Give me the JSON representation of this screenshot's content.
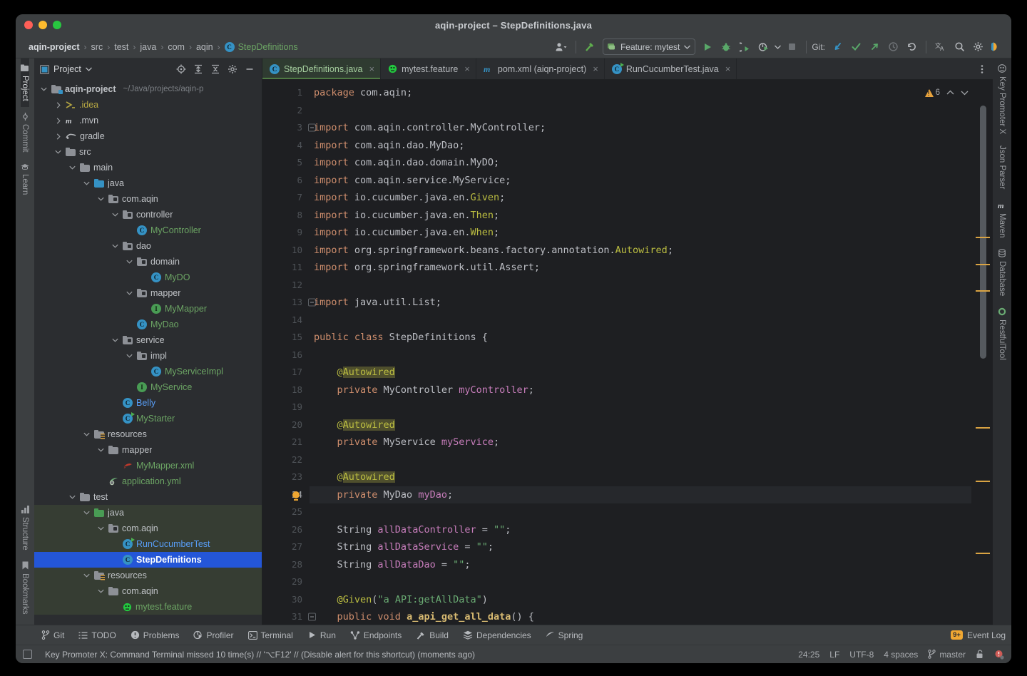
{
  "window": {
    "title": "aqin-project – StepDefinitions.java",
    "traffic_lights": [
      "close-red",
      "minimize-yellow",
      "maximize-green"
    ]
  },
  "breadcrumb": {
    "items": [
      "aqin-project",
      "src",
      "test",
      "java",
      "com",
      "aqin"
    ],
    "leaf": "StepDefinitions",
    "separator": "›"
  },
  "toolbar": {
    "run_config_label": "Feature: mytest",
    "git_label": "Git:",
    "icons": [
      "user-avatar-icon",
      "build-hammer-icon",
      "run-icon",
      "debug-icon",
      "run-with-coverage-icon",
      "profiler-icon",
      "stop-icon",
      "git-update-icon",
      "git-commit-check-icon",
      "git-push-icon",
      "history-icon",
      "rollback-icon",
      "translate-icon",
      "search-icon",
      "settings-gear-icon",
      "ai-assistant-icon"
    ]
  },
  "left_strip": {
    "top": [
      {
        "label": "Project",
        "icon": "project-icon",
        "active": true
      },
      {
        "label": "Commit",
        "icon": "commit-icon",
        "active": false
      },
      {
        "label": "Learn",
        "icon": "learn-icon",
        "active": false
      }
    ],
    "bottom": [
      {
        "label": "Structure",
        "icon": "structure-icon",
        "active": false
      },
      {
        "label": "Bookmarks",
        "icon": "bookmarks-icon",
        "active": false
      }
    ]
  },
  "right_strip": {
    "items": [
      {
        "label": "Key Promoter X",
        "icon": "key-promoter-icon"
      },
      {
        "label": "Json Parser",
        "icon": "json-parser-icon"
      },
      {
        "label": "Maven",
        "icon": "maven-icon"
      },
      {
        "label": "Database",
        "icon": "database-icon"
      },
      {
        "label": "RestfulTool",
        "icon": "restful-tool-icon"
      }
    ]
  },
  "project_panel": {
    "title": "Project",
    "dropdown_icon": "chevron-down-icon",
    "actions": [
      "locate-icon",
      "expand-all-icon",
      "collapse-all-icon",
      "settings-gear-icon",
      "hide-icon"
    ],
    "tree": [
      {
        "depth": 0,
        "arrow": "down",
        "icon": "module-folder",
        "label": "aqin-project",
        "sub": "~/Java/projects/aqin-p",
        "bold": true,
        "color": "default"
      },
      {
        "depth": 1,
        "arrow": "right",
        "icon": "idea-folder",
        "label": ".idea",
        "color": "yellow"
      },
      {
        "depth": 1,
        "arrow": "right",
        "icon": "maven-icon",
        "label": ".mvn",
        "color": "default"
      },
      {
        "depth": 1,
        "arrow": "right",
        "icon": "gradle-icon",
        "label": "gradle",
        "color": "default"
      },
      {
        "depth": 1,
        "arrow": "down",
        "icon": "folder",
        "label": "src",
        "color": "default"
      },
      {
        "depth": 2,
        "arrow": "down",
        "icon": "folder",
        "label": "main",
        "color": "default"
      },
      {
        "depth": 3,
        "arrow": "down",
        "icon": "source-folder",
        "label": "java",
        "color": "default"
      },
      {
        "depth": 4,
        "arrow": "down",
        "icon": "package",
        "label": "com.aqin",
        "color": "default"
      },
      {
        "depth": 5,
        "arrow": "down",
        "icon": "package",
        "label": "controller",
        "color": "default"
      },
      {
        "depth": 6,
        "arrow": "none",
        "icon": "class",
        "label": "MyController",
        "color": "green"
      },
      {
        "depth": 5,
        "arrow": "down",
        "icon": "package",
        "label": "dao",
        "color": "default"
      },
      {
        "depth": 6,
        "arrow": "down",
        "icon": "package",
        "label": "domain",
        "color": "default"
      },
      {
        "depth": 7,
        "arrow": "none",
        "icon": "class",
        "label": "MyDO",
        "color": "green"
      },
      {
        "depth": 6,
        "arrow": "down",
        "icon": "package",
        "label": "mapper",
        "color": "default"
      },
      {
        "depth": 7,
        "arrow": "none",
        "icon": "interface",
        "label": "MyMapper",
        "color": "green"
      },
      {
        "depth": 6,
        "arrow": "none",
        "icon": "class",
        "label": "MyDao",
        "color": "green"
      },
      {
        "depth": 5,
        "arrow": "down",
        "icon": "package",
        "label": "service",
        "color": "default"
      },
      {
        "depth": 6,
        "arrow": "down",
        "icon": "package",
        "label": "impl",
        "color": "default"
      },
      {
        "depth": 7,
        "arrow": "none",
        "icon": "class",
        "label": "MyServiceImpl",
        "color": "green"
      },
      {
        "depth": 6,
        "arrow": "none",
        "icon": "interface",
        "label": "MyService",
        "color": "green"
      },
      {
        "depth": 5,
        "arrow": "none",
        "icon": "class",
        "label": "Belly",
        "color": "blue"
      },
      {
        "depth": 5,
        "arrow": "none",
        "icon": "class-runnable",
        "label": "MyStarter",
        "color": "green"
      },
      {
        "depth": 3,
        "arrow": "down",
        "icon": "resource-folder",
        "label": "resources",
        "color": "default"
      },
      {
        "depth": 4,
        "arrow": "down",
        "icon": "folder",
        "label": "mapper",
        "color": "default"
      },
      {
        "depth": 5,
        "arrow": "none",
        "icon": "mybatis-xml",
        "label": "MyMapper.xml",
        "color": "green"
      },
      {
        "depth": 4,
        "arrow": "none",
        "icon": "yml-icon",
        "label": "application.yml",
        "color": "green"
      },
      {
        "depth": 2,
        "arrow": "down",
        "icon": "folder",
        "label": "test",
        "color": "default"
      },
      {
        "depth": 3,
        "arrow": "down",
        "icon": "test-source-folder",
        "label": "java",
        "color": "default",
        "scope": "test"
      },
      {
        "depth": 4,
        "arrow": "down",
        "icon": "package",
        "label": "com.aqin",
        "color": "default",
        "scope": "test"
      },
      {
        "depth": 5,
        "arrow": "none",
        "icon": "class-runnable",
        "label": "RunCucumberTest",
        "color": "blue",
        "scope": "test"
      },
      {
        "depth": 5,
        "arrow": "none",
        "icon": "class",
        "label": "StepDefinitions",
        "color": "default",
        "scope": "test",
        "selected": true
      },
      {
        "depth": 3,
        "arrow": "down",
        "icon": "test-resource-folder",
        "label": "resources",
        "color": "default",
        "scope": "test"
      },
      {
        "depth": 4,
        "arrow": "down",
        "icon": "folder",
        "label": "com.aqin",
        "color": "default",
        "scope": "test"
      },
      {
        "depth": 5,
        "arrow": "none",
        "icon": "cucumber-icon",
        "label": "mytest.feature",
        "color": "green",
        "scope": "test"
      }
    ]
  },
  "editor_tabs": [
    {
      "label": "StepDefinitions.java",
      "icon": "java-class-icon",
      "active": true,
      "close": "×"
    },
    {
      "label": "mytest.feature",
      "icon": "cucumber-icon",
      "active": false,
      "close": "×"
    },
    {
      "label": "pom.xml (aiqn-project)",
      "icon": "maven-icon",
      "active": false,
      "close": "×"
    },
    {
      "label": "RunCucumberTest.java",
      "icon": "java-test-icon",
      "active": false,
      "close": "×"
    }
  ],
  "editor": {
    "inspection_count": "6",
    "inspection_icon": "warning-triangle-icon",
    "up_icon": "chevron-up-icon",
    "down_icon": "chevron-down-icon",
    "current_line": 24,
    "lines": [
      {
        "n": 1,
        "tokens": [
          {
            "t": "package ",
            "c": "k"
          },
          {
            "t": "com.aqin",
            "c": "n"
          },
          {
            "t": ";",
            "c": "p"
          }
        ]
      },
      {
        "n": 2,
        "tokens": []
      },
      {
        "n": 3,
        "fold": true,
        "tokens": [
          {
            "t": "import ",
            "c": "k"
          },
          {
            "t": "com.aqin.controller.MyController",
            "c": "n"
          },
          {
            "t": ";",
            "c": "p"
          }
        ]
      },
      {
        "n": 4,
        "tokens": [
          {
            "t": "import ",
            "c": "k"
          },
          {
            "t": "com.aqin.dao.MyDao",
            "c": "n"
          },
          {
            "t": ";",
            "c": "p"
          }
        ]
      },
      {
        "n": 5,
        "tokens": [
          {
            "t": "import ",
            "c": "k"
          },
          {
            "t": "com.aqin.dao.domain.MyDO",
            "c": "n"
          },
          {
            "t": ";",
            "c": "p"
          }
        ]
      },
      {
        "n": 6,
        "tokens": [
          {
            "t": "import ",
            "c": "k"
          },
          {
            "t": "com.aqin.service.MyService",
            "c": "n"
          },
          {
            "t": ";",
            "c": "p"
          }
        ]
      },
      {
        "n": 7,
        "tokens": [
          {
            "t": "import ",
            "c": "k"
          },
          {
            "t": "io.cucumber.java.en.",
            "c": "n"
          },
          {
            "t": "Given",
            "c": "a"
          },
          {
            "t": ";",
            "c": "p"
          }
        ]
      },
      {
        "n": 8,
        "tokens": [
          {
            "t": "import ",
            "c": "k"
          },
          {
            "t": "io.cucumber.java.en.",
            "c": "n"
          },
          {
            "t": "Then",
            "c": "a"
          },
          {
            "t": ";",
            "c": "p"
          }
        ]
      },
      {
        "n": 9,
        "tokens": [
          {
            "t": "import ",
            "c": "k"
          },
          {
            "t": "io.cucumber.java.en.",
            "c": "n"
          },
          {
            "t": "When",
            "c": "a"
          },
          {
            "t": ";",
            "c": "p"
          }
        ]
      },
      {
        "n": 10,
        "tokens": [
          {
            "t": "import ",
            "c": "k"
          },
          {
            "t": "org.springframework.beans.factory.annotation.",
            "c": "n"
          },
          {
            "t": "Autowired",
            "c": "a"
          },
          {
            "t": ";",
            "c": "p"
          }
        ]
      },
      {
        "n": 11,
        "tokens": [
          {
            "t": "import ",
            "c": "k"
          },
          {
            "t": "org.springframework.util.Assert",
            "c": "n"
          },
          {
            "t": ";",
            "c": "p"
          }
        ]
      },
      {
        "n": 12,
        "tokens": []
      },
      {
        "n": 13,
        "fold": true,
        "tokens": [
          {
            "t": "import ",
            "c": "k"
          },
          {
            "t": "java.util.List",
            "c": "n"
          },
          {
            "t": ";",
            "c": "p"
          }
        ]
      },
      {
        "n": 14,
        "tokens": []
      },
      {
        "n": 15,
        "tokens": [
          {
            "t": "public class ",
            "c": "k"
          },
          {
            "t": "StepDefinitions",
            "c": "n"
          },
          {
            "t": " {",
            "c": "p"
          }
        ]
      },
      {
        "n": 16,
        "tokens": []
      },
      {
        "n": 17,
        "tokens": [
          {
            "t": "    ",
            "c": "p"
          },
          {
            "t": "@",
            "c": "a"
          },
          {
            "t": "Autowired",
            "c": "hl"
          }
        ]
      },
      {
        "n": 18,
        "tokens": [
          {
            "t": "    ",
            "c": "p"
          },
          {
            "t": "private ",
            "c": "k"
          },
          {
            "t": "MyController ",
            "c": "n"
          },
          {
            "t": "myController",
            "c": "f"
          },
          {
            "t": ";",
            "c": "p"
          }
        ]
      },
      {
        "n": 19,
        "tokens": []
      },
      {
        "n": 20,
        "tokens": [
          {
            "t": "    ",
            "c": "p"
          },
          {
            "t": "@",
            "c": "a"
          },
          {
            "t": "Autowired",
            "c": "hl"
          }
        ]
      },
      {
        "n": 21,
        "tokens": [
          {
            "t": "    ",
            "c": "p"
          },
          {
            "t": "private ",
            "c": "k"
          },
          {
            "t": "MyService ",
            "c": "n"
          },
          {
            "t": "myService",
            "c": "f"
          },
          {
            "t": ";",
            "c": "p"
          }
        ]
      },
      {
        "n": 22,
        "tokens": []
      },
      {
        "n": 23,
        "tokens": [
          {
            "t": "    ",
            "c": "p"
          },
          {
            "t": "@",
            "c": "a"
          },
          {
            "t": "Autowired",
            "c": "hl"
          }
        ]
      },
      {
        "n": 24,
        "bulb": true,
        "cur": true,
        "tokens": [
          {
            "t": "    ",
            "c": "p"
          },
          {
            "t": "private ",
            "c": "k"
          },
          {
            "t": "MyDao ",
            "c": "n"
          },
          {
            "t": "myDao",
            "c": "f"
          },
          {
            "t": ";",
            "c": "p"
          }
        ]
      },
      {
        "n": 25,
        "tokens": []
      },
      {
        "n": 26,
        "tokens": [
          {
            "t": "    ",
            "c": "p"
          },
          {
            "t": "String ",
            "c": "n"
          },
          {
            "t": "allDataController",
            "c": "f"
          },
          {
            "t": " = ",
            "c": "p"
          },
          {
            "t": "\"\"",
            "c": "s"
          },
          {
            "t": ";",
            "c": "p"
          }
        ]
      },
      {
        "n": 27,
        "tokens": [
          {
            "t": "    ",
            "c": "p"
          },
          {
            "t": "String ",
            "c": "n"
          },
          {
            "t": "allDataService",
            "c": "f"
          },
          {
            "t": " = ",
            "c": "p"
          },
          {
            "t": "\"\"",
            "c": "s"
          },
          {
            "t": ";",
            "c": "p"
          }
        ]
      },
      {
        "n": 28,
        "tokens": [
          {
            "t": "    ",
            "c": "p"
          },
          {
            "t": "String ",
            "c": "n"
          },
          {
            "t": "allDataDao",
            "c": "f"
          },
          {
            "t": " = ",
            "c": "p"
          },
          {
            "t": "\"\"",
            "c": "s"
          },
          {
            "t": ";",
            "c": "p"
          }
        ]
      },
      {
        "n": 29,
        "tokens": []
      },
      {
        "n": 30,
        "tokens": [
          {
            "t": "    ",
            "c": "p"
          },
          {
            "t": "@Given",
            "c": "a"
          },
          {
            "t": "(",
            "c": "p"
          },
          {
            "t": "\"a API:getAllData\"",
            "c": "s"
          },
          {
            "t": ")",
            "c": "p"
          }
        ]
      },
      {
        "n": 31,
        "fold": true,
        "tokens": [
          {
            "t": "    ",
            "c": "p"
          },
          {
            "t": "public void ",
            "c": "k"
          },
          {
            "t": "a_api_get_all_data",
            "c": "mn"
          },
          {
            "t": "() {",
            "c": "p"
          }
        ]
      }
    ]
  },
  "bottom_tool_window": {
    "items": [
      {
        "label": "Git",
        "icon": "git-branch-icon"
      },
      {
        "label": "TODO",
        "icon": "todo-list-icon"
      },
      {
        "label": "Problems",
        "icon": "problems-icon"
      },
      {
        "label": "Profiler",
        "icon": "profiler-icon"
      },
      {
        "label": "Terminal",
        "icon": "terminal-icon"
      },
      {
        "label": "Run",
        "icon": "run-icon"
      },
      {
        "label": "Endpoints",
        "icon": "endpoints-icon"
      },
      {
        "label": "Build",
        "icon": "build-hammer-icon"
      },
      {
        "label": "Dependencies",
        "icon": "dependencies-icon"
      },
      {
        "label": "Spring",
        "icon": "spring-leaf-icon"
      }
    ],
    "event_log": {
      "label": "Event Log",
      "badge": "9+",
      "icon": "event-log-icon"
    }
  },
  "statusbar": {
    "message": "Key Promoter X: Command Terminal missed 10 time(s) // '⌥F12' // (Disable alert for this shortcut) (moments ago)",
    "message_icon": "notification-icon",
    "caret_position": "24:25",
    "line_separator": "LF",
    "encoding": "UTF-8",
    "indent": "4 spaces",
    "branch": "master",
    "branch_icon": "git-branch-icon",
    "lock_icon": "read-write-lock-icon",
    "inspection_icon": "inspection-level-icon"
  },
  "colors": {
    "accent_blue": "#2456d8",
    "active_tab_bg": "#2f3b31",
    "editor_bg": "#1e1f22",
    "panel_bg": "#2b2d30",
    "chrome_bg": "#3c3f41",
    "keyword": "#cf8e6d",
    "string": "#6aab73",
    "annotation": "#bcbe41",
    "field": "#c77dbb",
    "method": "#d9bb72",
    "warning": "#e8a33d",
    "test_scope_bg": "#363d33"
  }
}
